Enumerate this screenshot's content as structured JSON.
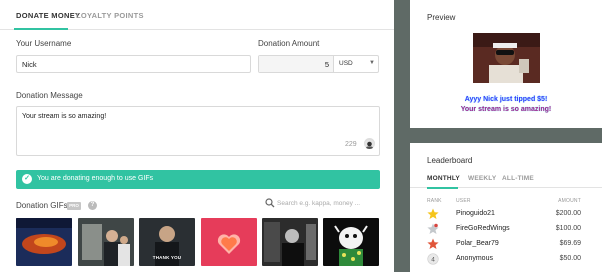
{
  "tabs": [
    "DONATE MONEY",
    "LOYALTY POINTS"
  ],
  "form": {
    "username_label": "Your Username",
    "username_value": "Nick",
    "amount_label": "Donation Amount",
    "amount_value": "5",
    "currency": "USD",
    "message_label": "Donation Message",
    "message_value": "Your stream is so amazing!",
    "char_count": "229"
  },
  "alert": {
    "text": "You are donating enough to use GIFs"
  },
  "gifs": {
    "label": "Donation GIFs",
    "badge": "PRO",
    "search_placeholder": "Search e.g. kappa, money ...",
    "items": [
      {
        "caption": ""
      },
      {
        "caption": ""
      },
      {
        "caption": "THANK YOU"
      },
      {
        "caption": ""
      },
      {
        "caption": ""
      },
      {
        "caption": ""
      }
    ]
  },
  "preview": {
    "title": "Preview",
    "line1": "Ayyy Nick just tipped $5!",
    "line2": "Your stream is so amazing!"
  },
  "leaderboard": {
    "title": "Leaderboard",
    "tabs": [
      "MONTHLY",
      "WEEKLY",
      "ALL-TIME"
    ],
    "headers": {
      "rank": "RANK",
      "user": "USER",
      "amount": "AMOUNT"
    },
    "rows": [
      {
        "rank": "1",
        "user": "Pinoguido21",
        "amount": "$200.00",
        "rank_icon": "gold-star-icon"
      },
      {
        "rank": "2",
        "user": "FireGoRedWings",
        "amount": "$100.00",
        "rank_icon": "silver-star-icon"
      },
      {
        "rank": "3",
        "user": "Polar_Bear79",
        "amount": "$69.69",
        "rank_icon": "bronze-star-icon"
      },
      {
        "rank": "4",
        "user": "Anonymous",
        "amount": "$50.00",
        "rank_icon": "rank-badge-icon"
      }
    ]
  },
  "colors": {
    "accent": "#31c3a2",
    "background": "#5f6a66"
  }
}
